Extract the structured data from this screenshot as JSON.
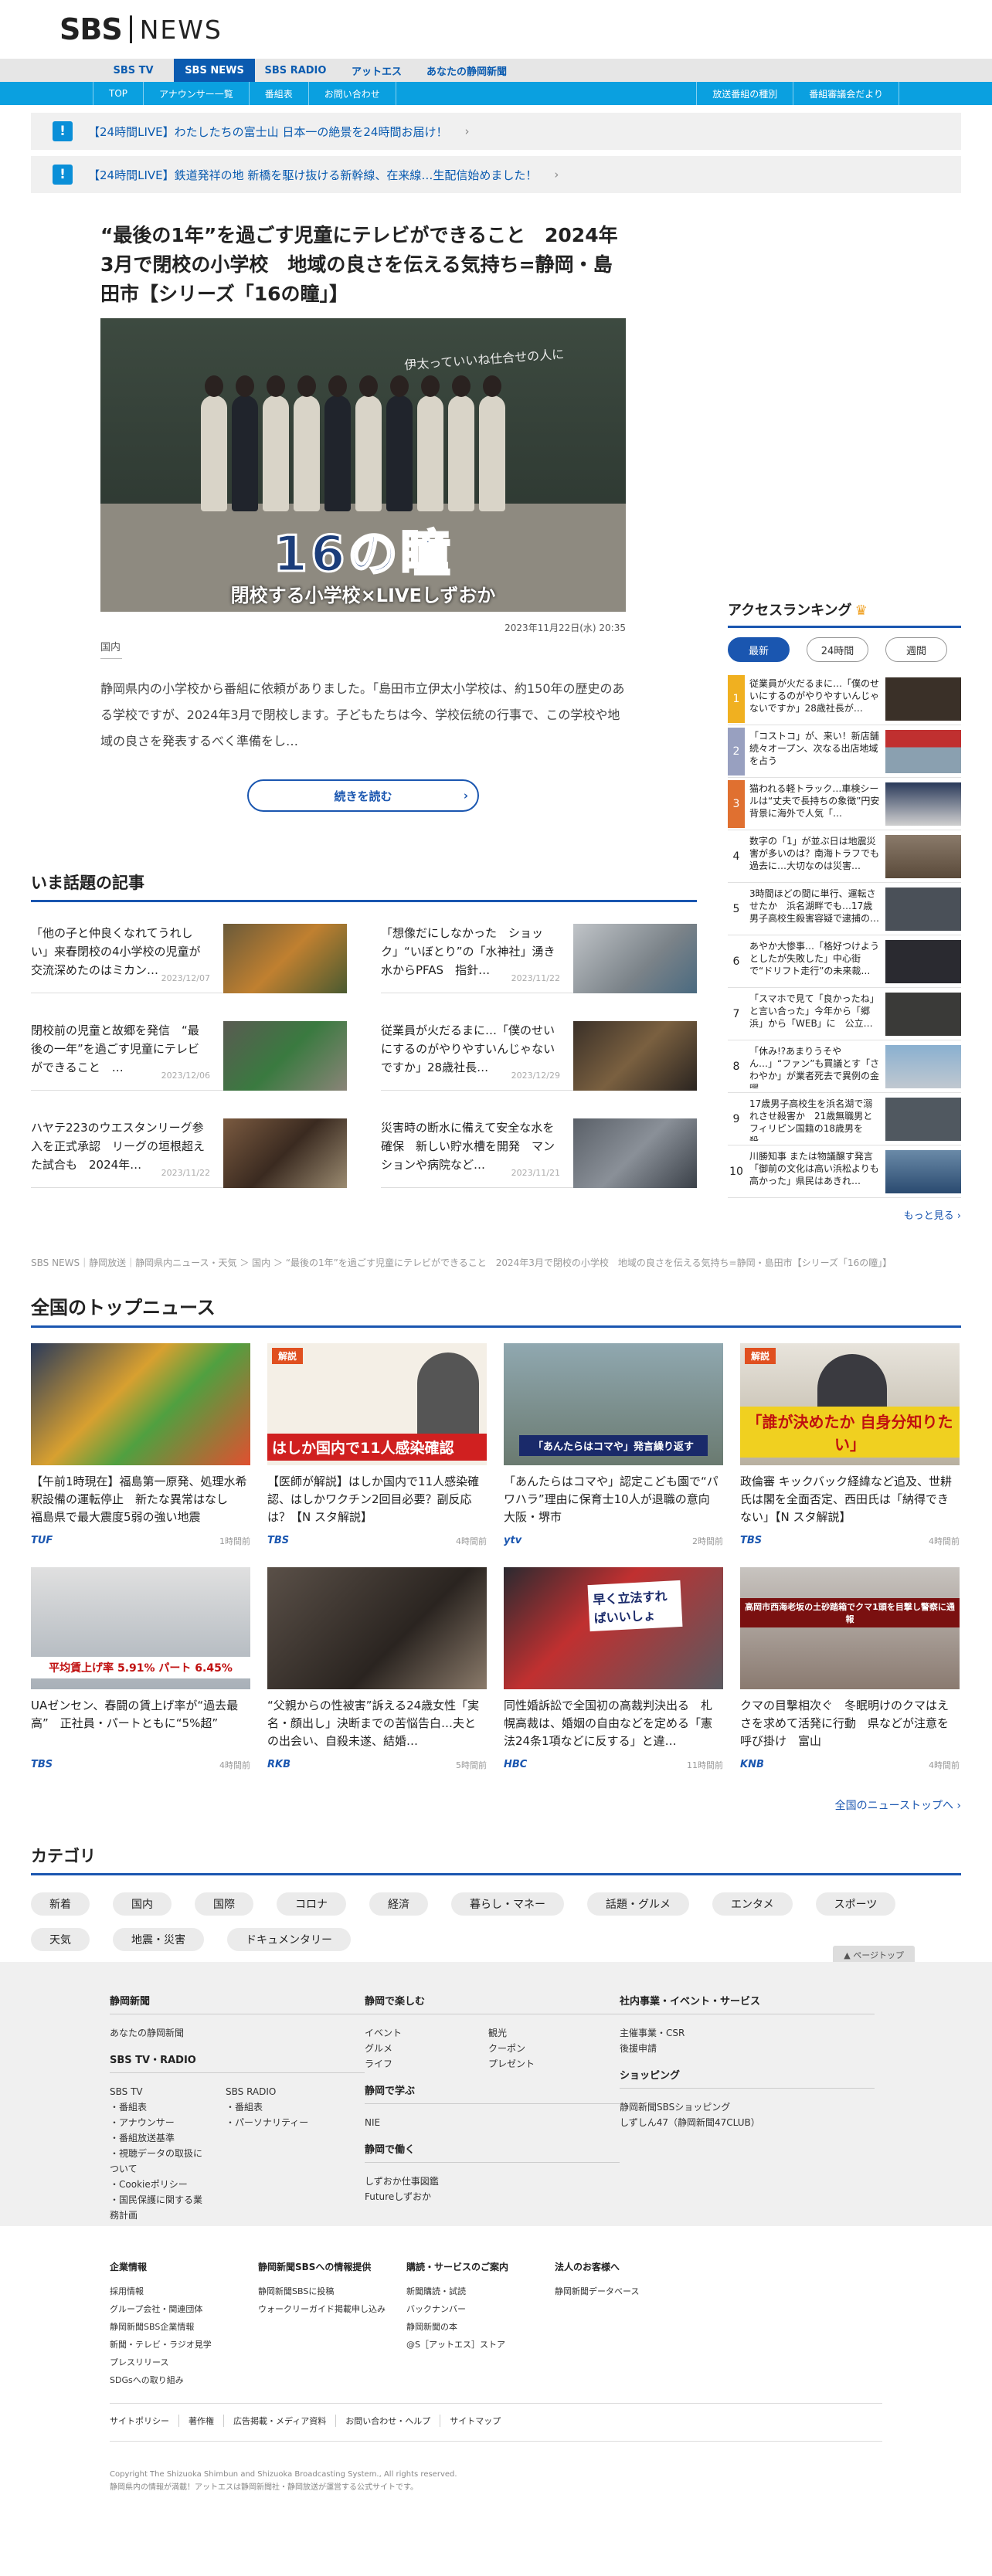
{
  "header": {
    "logo_sbs": "SBS",
    "logo_news": "NEWS"
  },
  "nav1": [
    "SBS TV",
    "SBS NEWS",
    "SBS RADIO",
    "アットエス",
    "あなたの静岡新聞"
  ],
  "nav2_left": [
    "TOP",
    "アナウンサー一覧",
    "番組表",
    "お問い合わせ"
  ],
  "nav2_right": [
    "放送番組の種別",
    "番組審議会だより"
  ],
  "live": [
    {
      "icon": "!",
      "text": "【24時間LIVE】わたしたちの富士山 日本一の絶景を24時間お届け！",
      "arrow": "›"
    },
    {
      "icon": "!",
      "text": "【24時間LIVE】鉄道発祥の地 新橋を駆け抜ける新幹線、在来線…生配信始めました！",
      "arrow": "›"
    }
  ],
  "article": {
    "title": "“最後の1年”を過ごす児童にテレビができること　2024年3月で閉校の小学校　地域の良さを伝える気持ち=静岡・島田市【シリーズ「16の瞳」】",
    "hero_big": "16の瞳",
    "hero_sub": "閉校する小学校×LIVEしずおか",
    "hero_chalk": "伊太っていいね仕合せの人に",
    "date": "2023年11月22日(水) 20:35",
    "category": "国内",
    "lead": "静岡県内の小学校から番組に依頼がありました。「島田市立伊太小学校は、約150年の歴史のある学校ですが、2024年3月で閉校します。子どもたちは今、学校伝統の行事で、この学校や地域の良さを発表するべく準備をし…",
    "more": "続きを読む",
    "more_arrow": "›"
  },
  "topics": {
    "heading": "いま話題の記事",
    "items": [
      {
        "title": "「他の子と仲良くなれてうれしい」来春閉校の4小学校の児童が交流深めたのはミカン…",
        "date": "2023/12/07"
      },
      {
        "title": "「想像だにしなかった　ショック」“いぼとり”の「水神社」湧き水からPFAS　指針…",
        "date": "2023/11/22"
      },
      {
        "title": "閉校前の児童と故郷を発信　“最後の一年”を過ごす児童にテレビができること　…",
        "date": "2023/12/06"
      },
      {
        "title": "従業員が火だるまに…「僕のせいにするのがやりやすいんじゃないですか」28歳社長…",
        "date": "2023/12/29"
      },
      {
        "title": "ハヤテ223のウエスタンリーグ参入を正式承認　リーグの垣根超えた試合も　2024年…",
        "date": "2023/11/22"
      },
      {
        "title": "災害時の断水に備えて安全な水を確保　新しい貯水槽を開発　マンションや病院など…",
        "date": "2023/11/21"
      }
    ]
  },
  "ranking": {
    "heading": "アクセスランキング",
    "crown": "♛",
    "tabs": [
      "最新",
      "24時間",
      "週間"
    ],
    "items": [
      {
        "n": "1",
        "text": "従業員が火だるまに…「僕のせいにするのがやりやすいんじゃないですか」28歳社長が…"
      },
      {
        "n": "2",
        "text": "「コストコ」が、来い！新店舗続々オープン、次なる出店地域を占う"
      },
      {
        "n": "3",
        "text": "猫われる軽トラック…車検シールは“丈夫で長持ちの象徴”円安背景に海外で人気「…"
      },
      {
        "n": "4",
        "text": "数字の「1」が並ぶ日は地震災害が多いのは？南海トラフでも過去に…大切なのは災害…"
      },
      {
        "n": "5",
        "text": "3時間ほどの間に単行、運転させたか　浜名湖畔でも…17歳男子高校生殺害容疑で逮捕の…"
      },
      {
        "n": "6",
        "text": "あやか大惨事…「格好つけようとしたが失敗した」中心街で“ドリフト走行”の未来裁…"
      },
      {
        "n": "7",
        "text": "「スマホで見て「良かったね」と言い合った」今年から「郷浜」から「WEB」に　公立…"
      },
      {
        "n": "8",
        "text": "「休み!?あまりうそやん…」“ファン”も買議とす「さわやか」が業者死去で異例の金曜…"
      },
      {
        "n": "9",
        "text": "17歳男子高校生を浜名湖で溺れさせ殺害か　21歳無職男とフィリピン国籍の18歳男を殺…"
      },
      {
        "n": "10",
        "text": "川勝知事 または物議醸す発言「御前の文化は高い浜松よりも高かった」県民はあきれ…"
      }
    ],
    "more": "もっと見る ›"
  },
  "breadcrumb": "SBS NEWS｜静岡放送｜静岡県内ニュース・天気 ＞ 国内 ＞ “最後の1年”を過ごす児童にテレビができること　2024年3月で閉校の小学校　地域の良さを伝える気持ち=静岡・島田市【シリーズ「16の瞳」】",
  "topnews": {
    "heading": "全国のトップニュース",
    "cards": [
      {
        "title": "【午前1時現在】福島第一原発、処理水希釈設備の運転停止　新たな異常はなし　福島県で最大震度5弱の強い地震",
        "src": "TUF",
        "time": "1時間前",
        "badge": "",
        "caption": ""
      },
      {
        "title": "【医師が解説】はしか国内で11人感染確認、はしかワクチン2回目必要？副反応は？【N スタ解説】",
        "src": "TBS",
        "time": "4時間前",
        "badge": "解説",
        "caption": "はしか国内で11人感染確認"
      },
      {
        "title": "「あんたらはコマや」認定こども園で“パワハラ”理由に保育士10人が退職の意向　大阪・堺市",
        "src": "ytv",
        "time": "2時間前",
        "badge": "",
        "caption": "「あんたらはコマや」発言繰り返す"
      },
      {
        "title": "政倫審 キックバック経緯など追及、世耕氏は閣を全面否定、西田氏は「納得できない」【N スタ解説】",
        "src": "TBS",
        "time": "4時間前",
        "badge": "解説",
        "caption": "「誰が決めたか 自身分知りたい」"
      },
      {
        "title": "UAゼンセン、春闘の賃上げ率が“過去最高”　正社員・パートともに“5%超”",
        "src": "TBS",
        "time": "4時間前",
        "badge": "",
        "caption": "平均賃上げ率 5.91%  パート 6.45%"
      },
      {
        "title": "“父親からの性被害”訴える24歳女性「実名・顔出し」決断までの苦悩告白…夫との出会い、自殺未遂、結婚…",
        "src": "RKB",
        "time": "5時間前",
        "badge": "",
        "caption": ""
      },
      {
        "title": "同性婚訴訟で全国初の高裁判決出る　札幌高裁は、婚姻の自由などを定める「憲法24条1項などに反する」と違…",
        "src": "HBC",
        "time": "11時間前",
        "badge": "",
        "caption": "早く立法すればいいしょ"
      },
      {
        "title": "クマの目撃相次ぐ　冬眠明けのクマはえさを求めて活発に行動　県などが注意を呼び掛け　富山",
        "src": "KNB",
        "time": "4時間前",
        "badge": "",
        "caption": "高岡市西海老坂の土砂踏箱でクマ1頭を目撃し警察に通報"
      }
    ],
    "more": "全国のニューストップへ ›"
  },
  "categories": {
    "heading": "カテゴリ",
    "items": [
      "新着",
      "国内",
      "国際",
      "コロナ",
      "経済",
      "暮らし・マネー",
      "話題・グルメ",
      "エンタメ",
      "スポーツ",
      "天気",
      "地震・災害",
      "ドキュメンタリー"
    ]
  },
  "pagetop": "▲ ページトップ",
  "footer": {
    "col1": {
      "h1": "静岡新聞",
      "l1": [
        "あなたの静岡新聞"
      ],
      "h2": "SBS TV・RADIO",
      "tv_h": "SBS TV",
      "tv": [
        "・番組表",
        "・アナウンサー",
        "・番組放送基準",
        "・視聴データの取扱について",
        "・Cookieポリシー",
        "・国民保護に関する業務計画"
      ],
      "radio_h": "SBS RADIO",
      "radio": [
        "・番組表",
        "・パーソナリティー"
      ]
    },
    "col2": {
      "h1": "静岡で楽しむ",
      "a": [
        "イベント",
        "グルメ",
        "ライフ"
      ],
      "b": [
        "観光",
        "クーポン",
        "プレゼント"
      ],
      "h2": "静岡で学ぶ",
      "l2": [
        "NIE"
      ],
      "h3": "静岡で働く",
      "l3": [
        "しずおか仕事図鑑",
        "Futureしずおか"
      ]
    },
    "col3": {
      "h1": "社内事業・イベント・サービス",
      "l1": [
        "主催事業・CSR",
        "後援申請"
      ],
      "h2": "ショッピング",
      "l2": [
        "静岡新聞SBSショッピング",
        "しずしん47（静岡新聞47CLUB）"
      ]
    },
    "b1": {
      "h": "企業情報",
      "l": [
        "採用情報",
        "グループ会社・関連団体",
        "静岡新聞SBS企業情報",
        "新聞・テレビ・ラジオ見学",
        "プレスリリース",
        "SDGsへの取り組み"
      ]
    },
    "b2": {
      "h": "静岡新聞SBSへの情報提供",
      "l": [
        "静岡新聞SBSに投稿",
        "ウォークリーガイド掲載申し込み"
      ]
    },
    "b3": {
      "h": "購読・サービスのご案内",
      "l": [
        "新聞購読・試読",
        "バックナンバー",
        "静岡新聞の本",
        "@S［アットエス］ストア"
      ]
    },
    "b4": {
      "h": "法人のお客様へ",
      "l": [
        "静岡新聞データベース"
      ]
    },
    "links": [
      "サイトポリシー",
      "著作権",
      "広告掲載・メディア資料",
      "お問い合わせ・ヘルプ",
      "サイトマップ"
    ],
    "copy1": "Copyright The Shizuoka Shimbun and Shizuoka Broadcasting System., All rights reserved.",
    "copy2": "静岡県内の情報が満載！アットエスは静岡新聞社・静岡放送が運営する公式サイトです。"
  },
  "colors": {
    "brand_blue": "#1a56b0",
    "nav2": "#0aa0e0",
    "live_icon": "#0a8fd8"
  }
}
